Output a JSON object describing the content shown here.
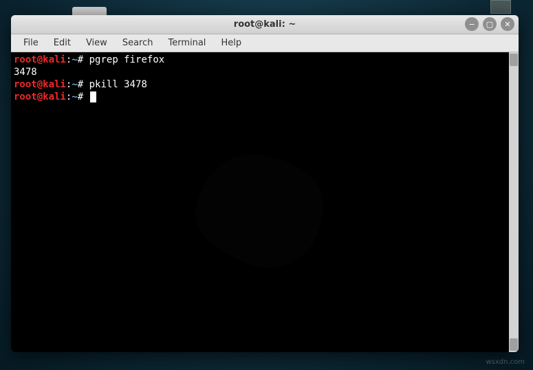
{
  "window": {
    "title": "root@kali: ~"
  },
  "menu": {
    "file": "File",
    "edit": "Edit",
    "view": "View",
    "search": "Search",
    "terminal": "Terminal",
    "help": "Help"
  },
  "terminal": {
    "lines": [
      {
        "user": "root@kali",
        "path": "~",
        "sym": "#",
        "cmd": "pgrep firefox"
      },
      {
        "output": "3478"
      },
      {
        "user": "root@kali",
        "path": "~",
        "sym": "#",
        "cmd": "pkill 3478"
      },
      {
        "user": "root@kali",
        "path": "~",
        "sym": "#",
        "cmd": "",
        "cursor": true
      }
    ]
  },
  "window_controls": {
    "minimize": "−",
    "maximize": "▢",
    "close": "✕"
  },
  "watermark": "wsxdn.com"
}
